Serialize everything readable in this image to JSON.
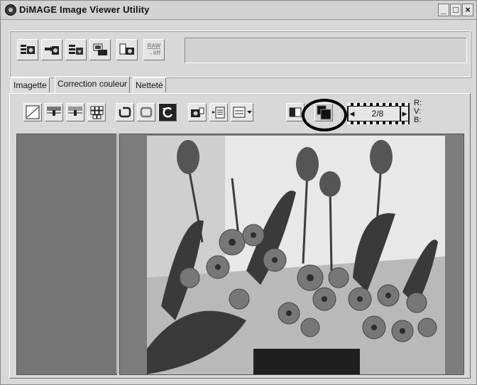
{
  "window": {
    "title": "DiMAGE Image Viewer Utility",
    "controls": [
      "_",
      "□",
      "×"
    ]
  },
  "tabs": [
    {
      "label": "Imagette",
      "active": false
    },
    {
      "label": "Correction couleur",
      "active": true
    },
    {
      "label": "Netteté",
      "active": false
    }
  ],
  "toolbar_top": {
    "raw_label_top": "RAW",
    "raw_label_bottom": "→tiff"
  },
  "frame_counter": {
    "value": "2/8"
  },
  "rgb_readout": {
    "r": "R:",
    "v": "V:",
    "b": "B:"
  }
}
